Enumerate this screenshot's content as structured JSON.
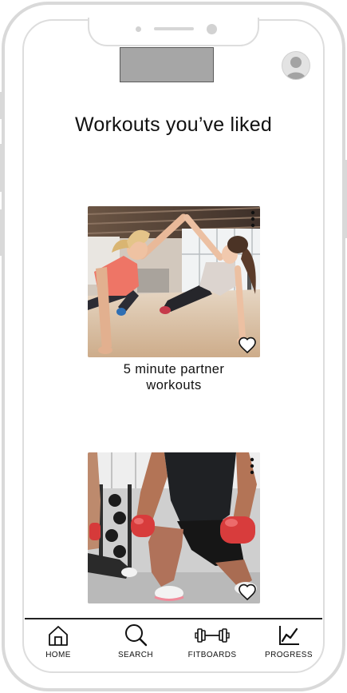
{
  "screen": {
    "title": "Workouts you’ve liked"
  },
  "header": {
    "avatar_icon": "user-avatar-icon"
  },
  "workouts": [
    {
      "caption": "5 minute partner workouts",
      "liked": true,
      "like_icon": "heart-icon",
      "menu_icon": "more-vertical-icon"
    },
    {
      "liked": true,
      "like_icon": "heart-icon",
      "menu_icon": "more-vertical-icon"
    }
  ],
  "nav": {
    "items": [
      {
        "label": "HOME",
        "icon": "home-icon"
      },
      {
        "label": "SEARCH",
        "icon": "search-icon"
      },
      {
        "label": "FITBOARDS",
        "icon": "dumbbell-icon"
      },
      {
        "label": "PROGRESS",
        "icon": "chart-line-icon"
      }
    ]
  },
  "colors": {
    "text": "#111111",
    "placeholder_fill": "#a6a6a6",
    "frame": "#d9d9d9"
  }
}
